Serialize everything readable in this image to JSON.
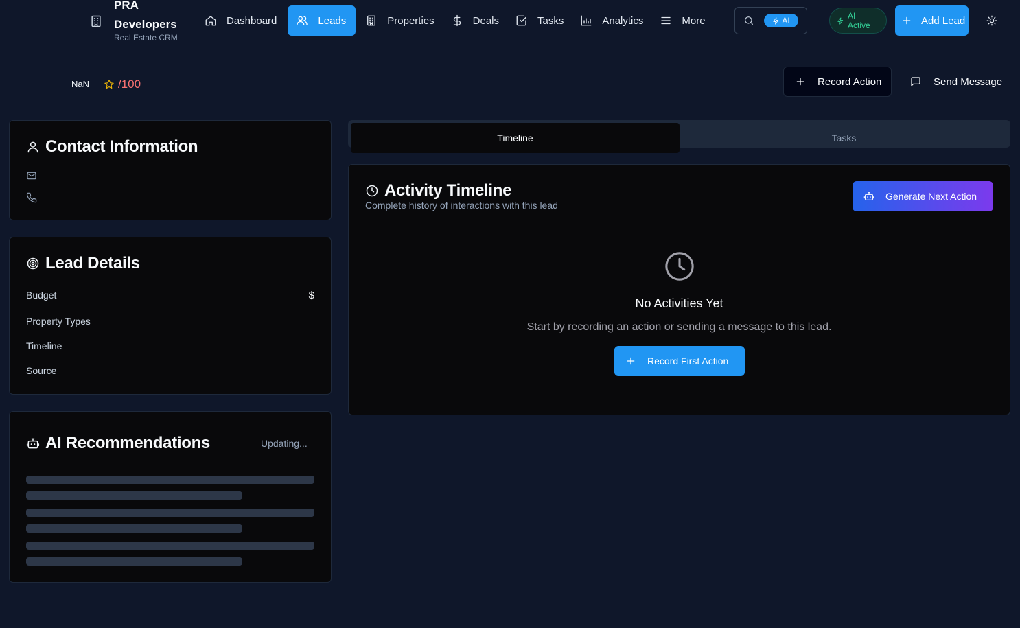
{
  "brand": {
    "name": "PRA Developers",
    "subtitle": "Real Estate CRM",
    "icon": "building-icon"
  },
  "nav": {
    "items": [
      {
        "label": "Dashboard",
        "icon": "home-icon",
        "active": false
      },
      {
        "label": "Leads",
        "icon": "users-icon",
        "active": true
      },
      {
        "label": "Properties",
        "icon": "building-icon",
        "active": false
      },
      {
        "label": "Deals",
        "icon": "dollar-icon",
        "active": false
      },
      {
        "label": "Tasks",
        "icon": "check-square-icon",
        "active": false
      },
      {
        "label": "Analytics",
        "icon": "bar-chart-icon",
        "active": false
      },
      {
        "label": "More",
        "icon": "menu-icon",
        "active": false
      }
    ]
  },
  "search": {
    "ai_chip": "AI"
  },
  "ai_status": {
    "label": "AI Active",
    "color": "#34d399"
  },
  "add_lead": {
    "label": "Add Lead"
  },
  "lead": {
    "name": "NaN",
    "score": "/100"
  },
  "actions": {
    "record": "Record Action",
    "message": "Send Message"
  },
  "contact": {
    "title": "Contact Information"
  },
  "details": {
    "title": "Lead Details",
    "rows": [
      {
        "label": "Budget",
        "value": "$"
      },
      {
        "label": "Property Types",
        "value": ""
      },
      {
        "label": "Timeline",
        "value": ""
      },
      {
        "label": "Source",
        "value": ""
      }
    ]
  },
  "ai_rec": {
    "title": "AI Recommendations",
    "status": "Updating..."
  },
  "tabs": [
    {
      "label": "Timeline",
      "active": true
    },
    {
      "label": "Tasks",
      "active": false
    }
  ],
  "timeline": {
    "title": "Activity Timeline",
    "subtitle": "Complete history of interactions with this lead",
    "generate_label": "Generate Next Action",
    "empty_title": "No Activities Yet",
    "empty_text": "Start by recording an action or sending a message to this lead.",
    "record_first_label": "Record First Action"
  },
  "colors": {
    "accent": "#2196f3",
    "background": "#0f172a",
    "card": "#09090b",
    "score": "#f87171",
    "star": "#eab308"
  }
}
